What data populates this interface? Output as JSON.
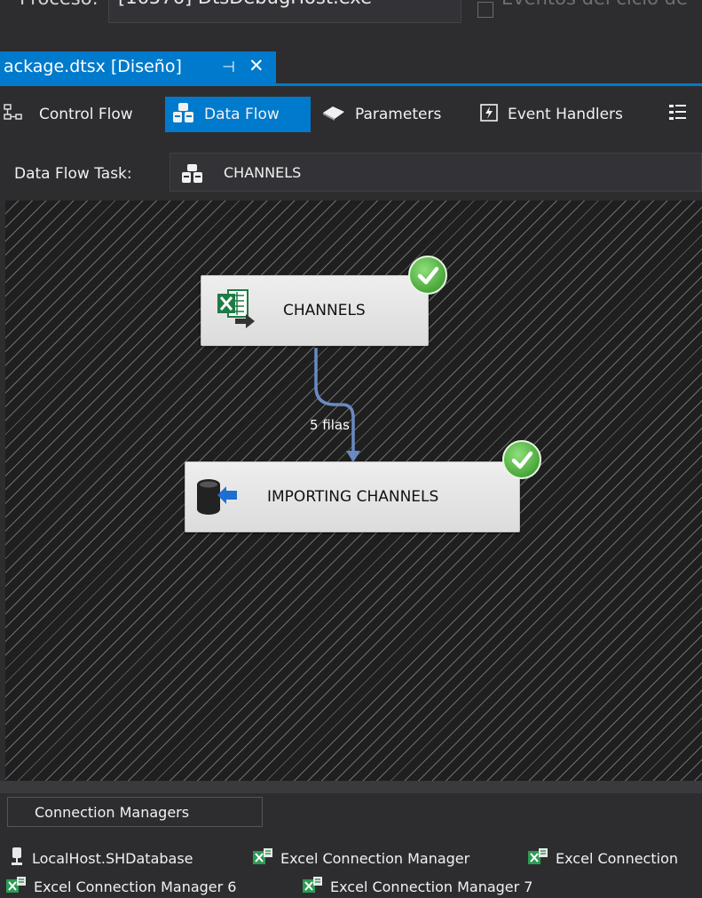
{
  "process_bar": {
    "label": "Proceso:",
    "selected_process": "[16576] DtsDebugHost.exe",
    "events_label": "Eventos del ciclo de"
  },
  "document_tab": {
    "title": "ackage.dtsx [Diseño]",
    "pin_glyph": "⊣",
    "close_glyph": "✕"
  },
  "designer_tabs": [
    {
      "label": "Control Flow",
      "icon": "control-flow-icon",
      "active": false
    },
    {
      "label": "Data Flow",
      "icon": "data-flow-icon",
      "active": true
    },
    {
      "label": "Parameters",
      "icon": "parameters-icon",
      "active": false
    },
    {
      "label": "Event Handlers",
      "icon": "event-handlers-icon",
      "active": false
    },
    {
      "label": "",
      "icon": "package-explorer-icon",
      "active": false
    }
  ],
  "data_flow_task": {
    "label": "Data Flow Task:",
    "value": "CHANNELS"
  },
  "canvas": {
    "nodes": [
      {
        "label": "CHANNELS",
        "icon": "excel-source-icon",
        "status": "success"
      },
      {
        "label": "IMPORTING CHANNELS",
        "icon": "database-destination-icon",
        "status": "success"
      }
    ],
    "path_label": "5 filas"
  },
  "connection_managers": {
    "tab_label": "Connection Managers",
    "items": [
      {
        "label": "LocalHost.SHDatabase",
        "icon": "oledb-connection-icon"
      },
      {
        "label": "Excel Connection Manager",
        "icon": "excel-connection-icon"
      },
      {
        "label": "Excel Connection",
        "icon": "excel-connection-icon"
      },
      {
        "label": "Excel Connection Manager 6",
        "icon": "excel-connection-icon"
      },
      {
        "label": "Excel Connection Manager 7",
        "icon": "excel-connection-icon"
      }
    ]
  },
  "colors": {
    "accent": "#007acc",
    "background": "#2d2d30",
    "success": "#4aa63a",
    "path": "#5a7bb0"
  }
}
